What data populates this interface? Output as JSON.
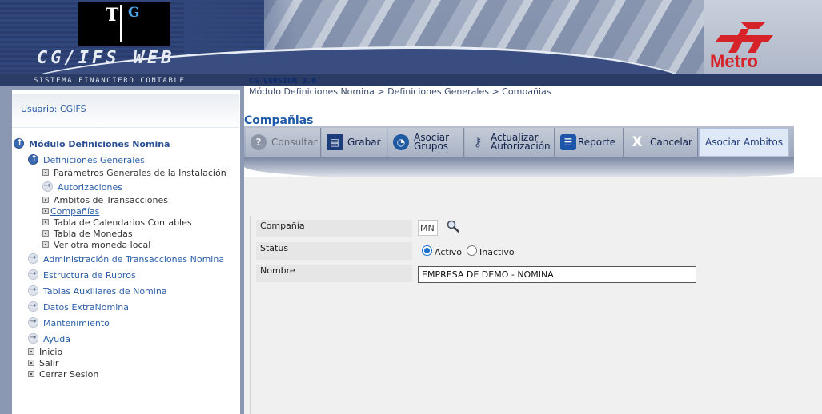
{
  "header": {
    "logo_letter_t": "T",
    "logo_letter_g": "G",
    "app_name": "CG/IFS  WEB",
    "app_subtitle": "SISTEMA FINANCIERO CONTABLE",
    "brand": "Metro",
    "version": "CG VERSION 3.0",
    "breadcrumb": "Módulo Definiciones Nomina > Definiciones Generales > Compañias",
    "brand_color": "#d6232a"
  },
  "sidebar": {
    "user_label": "Usuario: CGIFS",
    "module_title": "Módulo Definiciones Nomina",
    "section_definiciones": "Definiciones Generales",
    "sub_parametros": "Parámetros Generales de la Instalación",
    "sub_autorizaciones": "Autorizaciones",
    "sub_ambitos": "Ambitos de Transacciones",
    "sub_companias": "Compañías",
    "sub_calendarios": "Tabla de Calendarios Contables",
    "sub_monedas": "Tabla de Monedas",
    "sub_otra_moneda": "Ver otra moneda local",
    "section_admin": "Administración de Transacciones Nomina",
    "section_rubros": "Estructura de Rubros",
    "section_tablas": "Tablas Auxiliares de Nomina",
    "section_datos": "Datos ExtraNomina",
    "section_mantenimiento": "Mantenimiento",
    "section_ayuda": "Ayuda",
    "item_inicio": "Inicio",
    "item_salir": "Salir",
    "item_cerrar": "Cerrar Sesion"
  },
  "main": {
    "page_title": "Compañias",
    "toolbar": {
      "consultar": "Consultar",
      "grabar": "Grabar",
      "asociar_grupos_1": "Asociar",
      "asociar_grupos_2": "Grupos",
      "actualizar_1": "Actualizar",
      "actualizar_2": "Autorización",
      "reporte": "Reporte",
      "cancelar": "Cancelar",
      "asociar_ambitos": "Asociar Ambitos"
    },
    "form": {
      "compania_label": "Compañía",
      "compania_value": "MN",
      "status_label": "Status",
      "status_activo": "Activo",
      "status_inactivo": "Inactivo",
      "status_selected": "Activo",
      "nombre_label": "Nombre",
      "nombre_value": "EMPRESA DE DEMO - NOMINA"
    }
  }
}
